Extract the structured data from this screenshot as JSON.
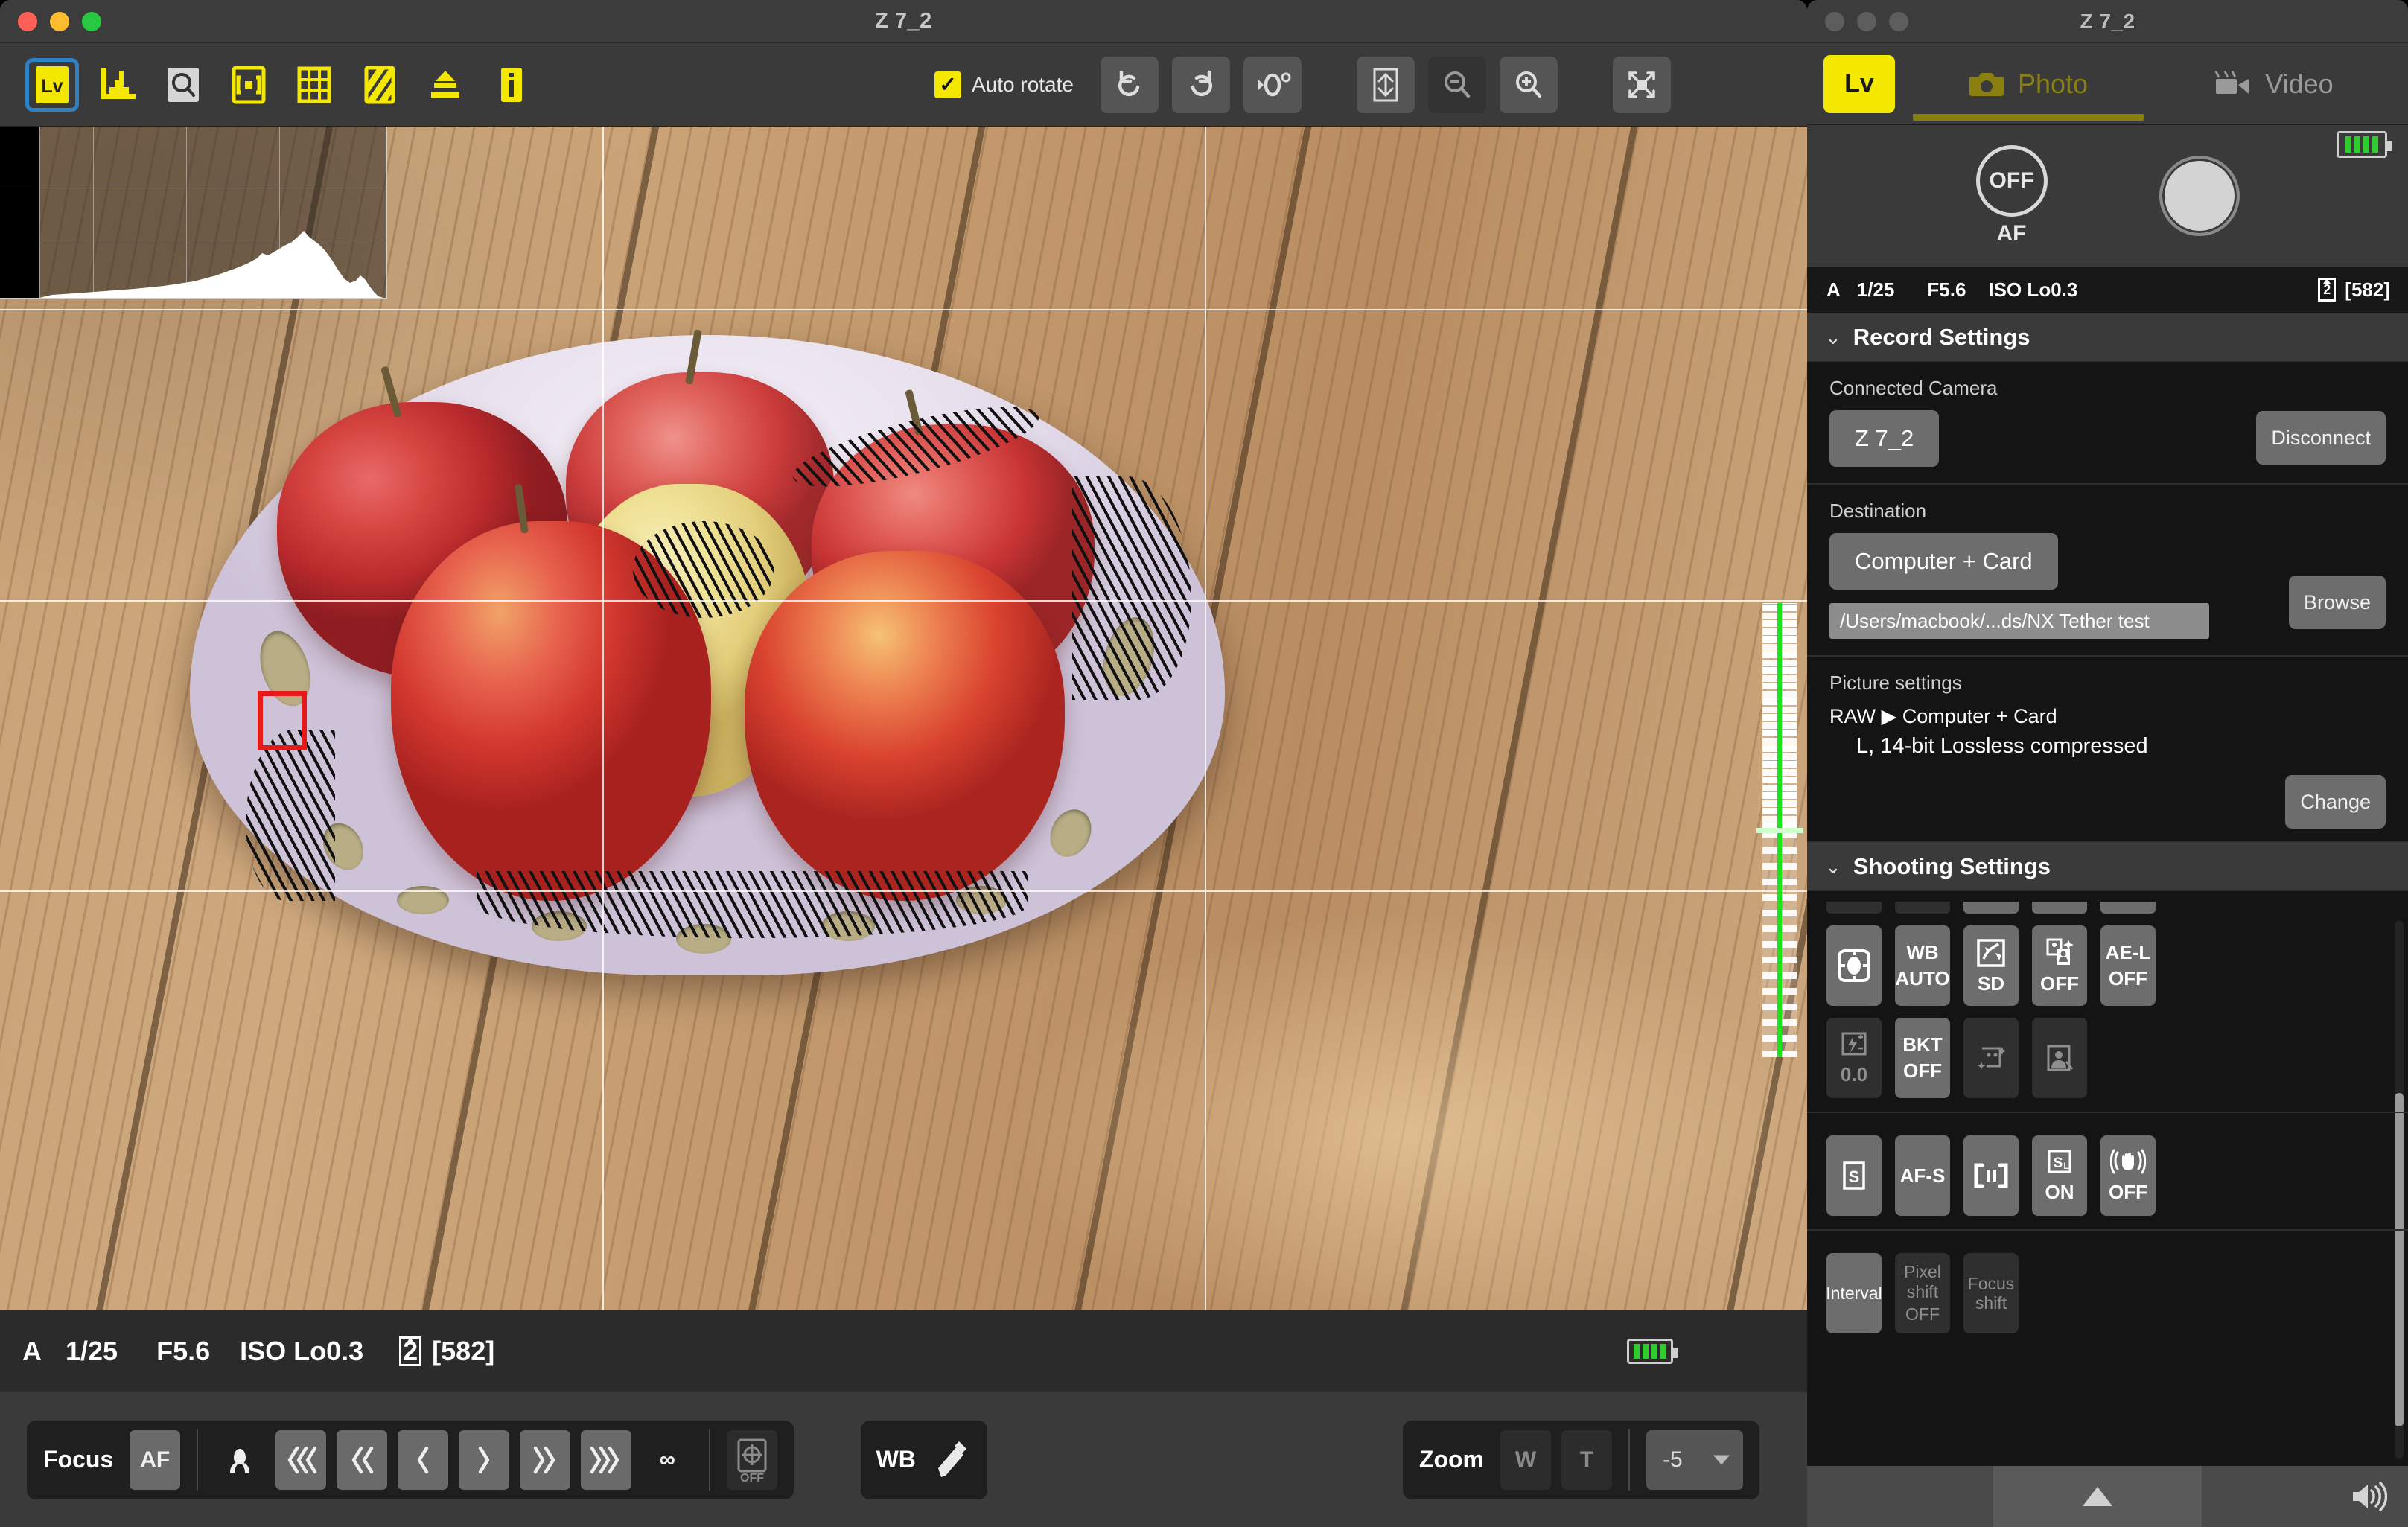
{
  "main_window": {
    "title": "Z 7_2",
    "toolbar": {
      "tools": [
        {
          "name": "live-view",
          "label": "Lv",
          "selected": true
        },
        {
          "name": "histogram",
          "label": "",
          "selected": false
        },
        {
          "name": "magnify-focus",
          "label": "",
          "selected": false
        },
        {
          "name": "focus-area",
          "label": "",
          "selected": false
        },
        {
          "name": "grid-overlay",
          "label": "",
          "selected": false
        },
        {
          "name": "highlight-warning",
          "label": "",
          "selected": false
        },
        {
          "name": "level-indicator",
          "label": "",
          "selected": false
        },
        {
          "name": "info",
          "label": "",
          "selected": false
        }
      ],
      "auto_rotate_label": "Auto rotate",
      "auto_rotate_checked": true,
      "rotate_left": "rotate-left",
      "rotate_right": "rotate-right",
      "reset_rotation": "0°",
      "fit_to_window": "fit-to-window",
      "zoom_out": "zoom-out",
      "zoom_in": "zoom-in",
      "fullscreen": "fullscreen"
    },
    "status_bar": {
      "mode": "A",
      "shutter": "1/25",
      "aperture": "F5.6",
      "iso": "ISO Lo0.3",
      "slot": "2",
      "remaining": "[582]"
    },
    "bottom_bar": {
      "focus_label": "Focus",
      "af_label": "AF",
      "focus_steps": [
        "macro",
        "«««",
        "««",
        "‹",
        "›",
        "»»",
        "»»»"
      ],
      "infinity": "∞",
      "af_lock": "OFF",
      "wb_label": "WB",
      "zoom_label": "Zoom",
      "zoom_wide": "W",
      "zoom_tele": "T",
      "zoom_value": "-5"
    }
  },
  "preview": {
    "histogram_title": "histogram-overlay",
    "af_point": "af-point-box",
    "level_horizontal": "virtual-horizon-roll",
    "level_vertical": "virtual-horizon-pitch",
    "grid": "composition-grid"
  },
  "camera_panel": {
    "title": "Z 7_2",
    "lv_label": "Lv",
    "tabs": [
      {
        "name": "photo",
        "label": "Photo",
        "active": true
      },
      {
        "name": "video",
        "label": "Video",
        "active": false
      }
    ],
    "power": {
      "dial": "OFF",
      "mode": "AF"
    },
    "status_bar": {
      "mode": "A",
      "shutter": "1/25",
      "aperture": "F5.6",
      "iso": "ISO Lo0.3",
      "slot": "2",
      "remaining": "[582]"
    },
    "record_settings": {
      "section_title": "Record Settings",
      "connected_camera_label": "Connected Camera",
      "camera_name": "Z 7_2",
      "disconnect_label": "Disconnect",
      "destination_label": "Destination",
      "destination_value": "Computer + Card",
      "destination_path": "/Users/macbook/...ds/NX Tether test",
      "browse_label": "Browse",
      "picture_settings_label": "Picture settings",
      "picture_line1": "RAW ▶ Computer + Card",
      "picture_line2": "L, 14-bit Lossless compressed",
      "change_label": "Change"
    },
    "shooting_settings": {
      "section_title": "Shooting Settings",
      "rows": [
        [
          {
            "name": "metering",
            "icon": "metering-icon",
            "top": "",
            "bottom": ""
          },
          {
            "name": "white-balance",
            "icon": "",
            "top": "WB",
            "bottom": "AUTO"
          },
          {
            "name": "picture-control",
            "icon": "picture-control-icon",
            "top": "",
            "bottom": "SD"
          },
          {
            "name": "active-d-lighting",
            "icon": "portrait-sparkle-icon",
            "top": "",
            "bottom": "OFF"
          },
          {
            "name": "ae-lock",
            "icon": "",
            "top": "AE-L",
            "bottom": "OFF"
          }
        ],
        [
          {
            "name": "flash-compensation",
            "icon": "flash-icon",
            "top": "",
            "bottom": "0.0",
            "disabled": true
          },
          {
            "name": "bracketing",
            "icon": "",
            "top": "BKT",
            "bottom": "OFF"
          },
          {
            "name": "hdr",
            "icon": "hdr-icon",
            "top": "",
            "bottom": "",
            "disabled": true
          },
          {
            "name": "portrait-impression",
            "icon": "portrait-icon",
            "top": "",
            "bottom": "",
            "disabled": true
          }
        ],
        [
          {
            "name": "release-mode",
            "icon": "",
            "top": "S",
            "bottom": ""
          },
          {
            "name": "focus-mode",
            "icon": "",
            "top": "AF-S",
            "bottom": ""
          },
          {
            "name": "af-area-mode",
            "icon": "af-area-icon",
            "top": "",
            "bottom": ""
          },
          {
            "name": "silent-shutter",
            "icon": "",
            "top": "SL",
            "bottom": "ON"
          },
          {
            "name": "vibration-reduction",
            "icon": "hand-icon",
            "top": "",
            "bottom": "OFF"
          }
        ],
        [
          {
            "name": "interval-timer",
            "icon": "",
            "top": "Interval",
            "bottom": ""
          },
          {
            "name": "pixel-shift",
            "icon": "",
            "top": "Pixel shift",
            "bottom": "OFF",
            "disabled": true
          },
          {
            "name": "focus-shift",
            "icon": "",
            "top": "Focus shift",
            "bottom": "",
            "disabled": true
          }
        ]
      ]
    },
    "footer": {
      "collapse": "collapse-arrow",
      "sound": "speaker-icon"
    }
  },
  "colors": {
    "accent_yellow": "#F5E800",
    "selection_blue": "#2D81C4",
    "af_red": "#E8191B",
    "level_green": "#19E619",
    "panel_dark": "#141414",
    "chrome": "#3A3A3A"
  }
}
